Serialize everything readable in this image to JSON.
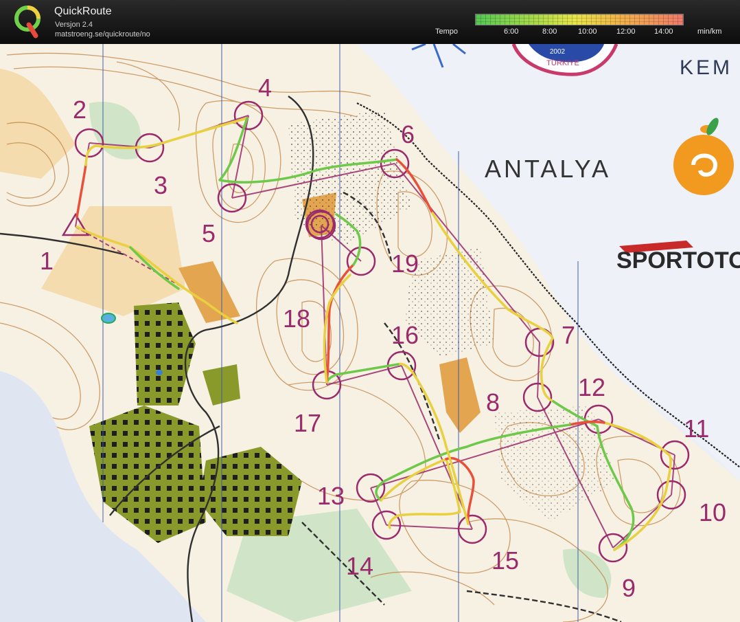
{
  "app": {
    "name": "QuickRoute",
    "version": "Versjon 2.4",
    "url": "matstroeng.se/quickroute/no"
  },
  "pace_scale": {
    "label": "Tempo",
    "ticks": [
      "6:00",
      "8:00",
      "10:00",
      "12:00",
      "14:00"
    ],
    "unit": "min/km",
    "colors": [
      "#55c855",
      "#e8e64a",
      "#f07a6a"
    ]
  },
  "map": {
    "logo_texts": {
      "antalya": "ANTALYA",
      "sportoto": "SPORTOTO",
      "sportoto_red": "TO",
      "kemer": "KEM",
      "turkiye": "TÜRKIYE",
      "year": "2002"
    },
    "controls": [
      "1",
      "2",
      "3",
      "4",
      "5",
      "6",
      "7",
      "8",
      "9",
      "10",
      "11",
      "12",
      "13",
      "14",
      "15",
      "16",
      "17",
      "18",
      "19"
    ],
    "colors": {
      "control_ring": "#9a2a6b",
      "contour": "#c4874a",
      "open_land": "#f2d7a0",
      "rough_open": "#e4a550",
      "settlement": "#8a9a2a",
      "track": "#303030"
    }
  }
}
